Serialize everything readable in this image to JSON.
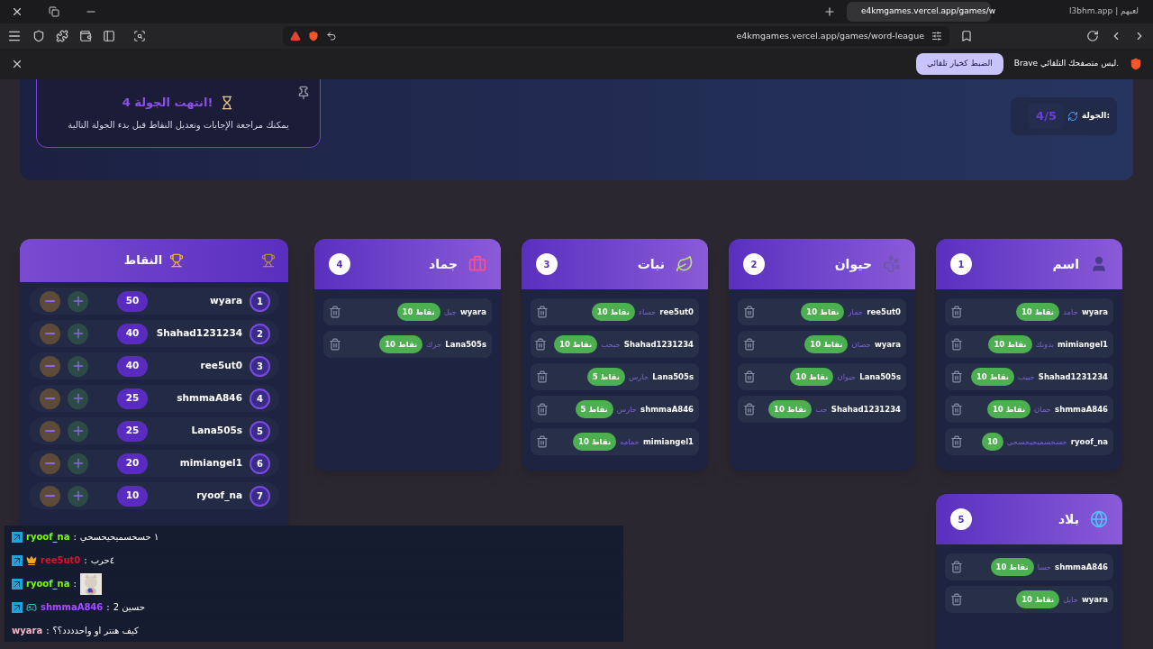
{
  "browser": {
    "tabs": [
      {
        "title": "l3bhm.app | لعبهم",
        "selected": false
      },
      {
        "title": "e4kmgames.vercel.app/games/w",
        "selected": true
      }
    ],
    "address": "e4kmgames.vercel.app/games/word-league",
    "infobar": {
      "message": "Brave ليس متصفحك التلقائي.",
      "button": "الضبط كخيار تلقائي"
    }
  },
  "round_banner": {
    "title": "انتهت الجولة 4!",
    "subtitle": "يمكنك مراجعة الإجابات وتعديل النقاط قبل بدء الجولة التالية"
  },
  "round_info": {
    "label": "الجولة:",
    "value": "4/5"
  },
  "categories": [
    {
      "kind": "person",
      "title": "اسم",
      "number": "1",
      "answers": [
        {
          "player": "wyara",
          "answer": "حامد",
          "points": "10 نقاط"
        },
        {
          "player": "mimiangel1",
          "answer": "بدونك",
          "points": "10 نقاط"
        },
        {
          "player": "Shahad1231234",
          "answer": "حبيب",
          "points": "10 نقاط"
        },
        {
          "player": "shmmaA846",
          "answer": "حمان",
          "points": "10 نقاط"
        },
        {
          "player": "ryoof_na",
          "answer": "حسحسميحيحسحي",
          "points": "10"
        }
      ]
    },
    {
      "kind": "animal",
      "title": "حيوان",
      "number": "2",
      "answers": [
        {
          "player": "ree5ut0",
          "answer": "حمار",
          "points": "10 نقاط"
        },
        {
          "player": "wyara",
          "answer": "حصان",
          "points": "10 نقاط"
        },
        {
          "player": "Lana505s",
          "answer": "حيوان",
          "points": "10 نقاط"
        },
        {
          "player": "Shahad1231234",
          "answer": "حب",
          "points": "10 نقاط"
        }
      ]
    },
    {
      "kind": "plant",
      "title": "نبات",
      "number": "3",
      "answers": [
        {
          "player": "ree5ut0",
          "answer": "حساء",
          "points": "10 نقاط"
        },
        {
          "player": "Shahad1231234",
          "answer": "حبحب",
          "points": "10 نقاط"
        },
        {
          "player": "Lana505s",
          "answer": "حارس",
          "points": "5 نقاط"
        },
        {
          "player": "shmmaA846",
          "answer": "حارس",
          "points": "5 نقاط"
        },
        {
          "player": "mimiangel1",
          "answer": "حمامه",
          "points": "10 نقاط"
        }
      ]
    },
    {
      "kind": "object",
      "title": "جماد",
      "number": "4",
      "answers": [
        {
          "player": "wyara",
          "answer": "جبل",
          "points": "10 نقاط"
        },
        {
          "player": "Lana505s",
          "answer": "حرك",
          "points": "10 نقاط"
        }
      ]
    },
    {
      "kind": "country",
      "title": "بلاد",
      "number": "5",
      "answers": [
        {
          "player": "shmmaA846",
          "answer": "حسا",
          "points": "10 نقاط"
        },
        {
          "player": "wyara",
          "answer": "حايل",
          "points": "10 نقاط"
        }
      ]
    }
  ],
  "scores": {
    "title": "النقاط",
    "rows": [
      {
        "rank": "1",
        "player": "wyara",
        "score": "50"
      },
      {
        "rank": "2",
        "player": "Shahad1231234",
        "score": "40"
      },
      {
        "rank": "3",
        "player": "ree5ut0",
        "score": "40"
      },
      {
        "rank": "4",
        "player": "shmmaA846",
        "score": "25"
      },
      {
        "rank": "5",
        "player": "Lana505s",
        "score": "25"
      },
      {
        "rank": "6",
        "player": "mimiangel1",
        "score": "20"
      },
      {
        "rank": "7",
        "player": "ryoof_na",
        "score": "10"
      }
    ]
  },
  "chat": [
    {
      "user": "ryoof_na",
      "color": "#7cfc00",
      "badges": [
        {
          "kind": "arrow"
        }
      ],
      "separator": ":",
      "kind": "text",
      "message": "١ حسحسميحيحسحي"
    },
    {
      "user": "ree5ut0",
      "color": "#e0102a",
      "badges": [
        {
          "kind": "arrow"
        },
        {
          "kind": "crown"
        }
      ],
      "separator": ":",
      "kind": "text",
      "message": "٤حرب"
    },
    {
      "user": "ryoof_na",
      "color": "#7cfc00",
      "badges": [
        {
          "kind": "arrow"
        }
      ],
      "separator": ":",
      "kind": "picture"
    },
    {
      "user": "shmmaA846",
      "color": "#a64dff",
      "badges": [
        {
          "kind": "arrow"
        },
        {
          "kind": "game"
        }
      ],
      "separator": ":",
      "kind": "text",
      "message": "حسين 2"
    },
    {
      "user": "wyara",
      "color": "#f2b8c6",
      "separator": ":",
      "kind": "text",
      "message": "كيف هنتر او واحدددد؟؟"
    }
  ]
}
